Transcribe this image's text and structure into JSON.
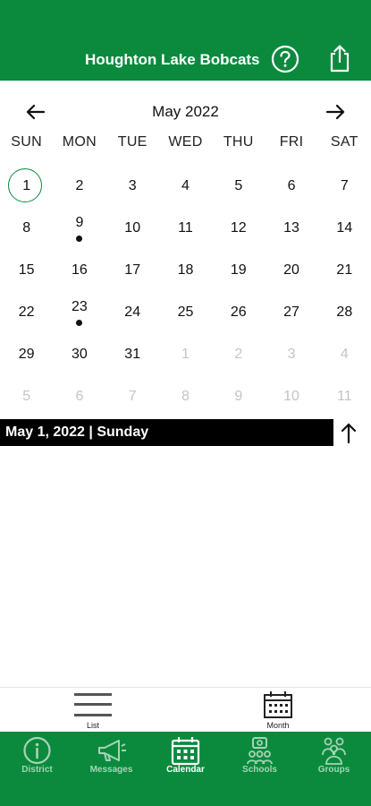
{
  "header": {
    "title": "Houghton Lake Bobcats",
    "help_icon": "question-circle-icon",
    "share_icon": "share-icon"
  },
  "colors": {
    "brand": "#0b8a3e",
    "tab_inactive": "#a5d4b4",
    "tab_active": "#ffffff"
  },
  "calendar": {
    "month_label": "May 2022",
    "weekdays": [
      "SUN",
      "MON",
      "TUE",
      "WED",
      "THU",
      "FRI",
      "SAT"
    ],
    "weeks": [
      [
        {
          "d": "1",
          "sel": true
        },
        {
          "d": "2"
        },
        {
          "d": "3"
        },
        {
          "d": "4"
        },
        {
          "d": "5"
        },
        {
          "d": "6"
        },
        {
          "d": "7"
        }
      ],
      [
        {
          "d": "8"
        },
        {
          "d": "9",
          "event": true
        },
        {
          "d": "10"
        },
        {
          "d": "11"
        },
        {
          "d": "12"
        },
        {
          "d": "13"
        },
        {
          "d": "14"
        }
      ],
      [
        {
          "d": "15"
        },
        {
          "d": "16"
        },
        {
          "d": "17"
        },
        {
          "d": "18"
        },
        {
          "d": "19"
        },
        {
          "d": "20"
        },
        {
          "d": "21"
        }
      ],
      [
        {
          "d": "22"
        },
        {
          "d": "23",
          "event": true
        },
        {
          "d": "24"
        },
        {
          "d": "25"
        },
        {
          "d": "26"
        },
        {
          "d": "27"
        },
        {
          "d": "28"
        }
      ],
      [
        {
          "d": "29"
        },
        {
          "d": "30"
        },
        {
          "d": "31"
        },
        {
          "d": "1",
          "out": true
        },
        {
          "d": "2",
          "out": true
        },
        {
          "d": "3",
          "out": true
        },
        {
          "d": "4",
          "out": true
        }
      ],
      [
        {
          "d": "5",
          "out": true
        },
        {
          "d": "6",
          "out": true
        },
        {
          "d": "7",
          "out": true
        },
        {
          "d": "8",
          "out": true
        },
        {
          "d": "9",
          "out": true
        },
        {
          "d": "10",
          "out": true
        },
        {
          "d": "11",
          "out": true
        }
      ]
    ]
  },
  "selected_date_label": "May 1, 2022 | Sunday",
  "view_toggle": {
    "list_label": "List",
    "month_label": "Month"
  },
  "tabs": [
    {
      "label": "District",
      "icon": "info-icon",
      "active": false
    },
    {
      "label": "Messages",
      "icon": "megaphone-icon",
      "active": false
    },
    {
      "label": "Calendar",
      "icon": "calendar-icon",
      "active": true
    },
    {
      "label": "Schools",
      "icon": "school-icon",
      "active": false
    },
    {
      "label": "Groups",
      "icon": "groups-icon",
      "active": false
    }
  ]
}
